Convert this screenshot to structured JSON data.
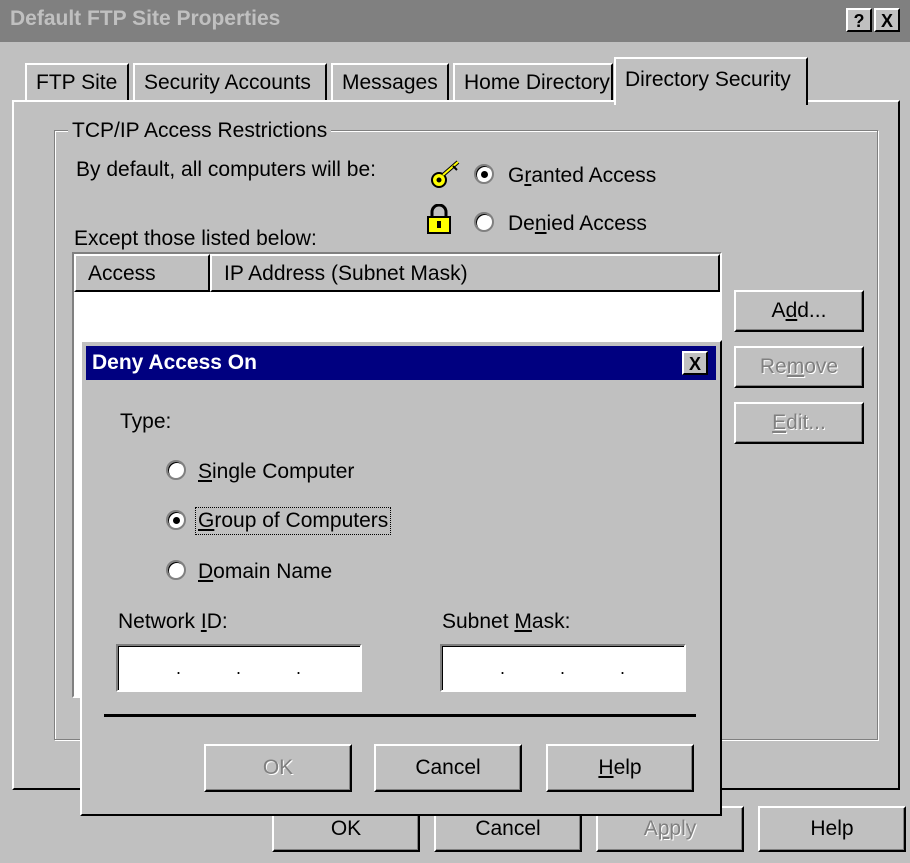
{
  "window": {
    "title": "Default FTP Site Properties",
    "help_btn": "?",
    "close_btn": "X"
  },
  "tabs": [
    {
      "label": "FTP Site"
    },
    {
      "label": "Security Accounts"
    },
    {
      "label": "Messages"
    },
    {
      "label": "Home Directory"
    },
    {
      "label": "Directory Security",
      "active": true
    }
  ],
  "restrictions": {
    "group_label": "TCP/IP Access Restrictions",
    "default_label": "By default, all computers will be:",
    "granted_pre": "G",
    "granted_u": "r",
    "granted_post": "anted Access",
    "denied_pre": "De",
    "denied_u": "n",
    "denied_post": "ied Access",
    "selected": "Granted Access",
    "except_label": "Except those listed below:",
    "columns": [
      "Access",
      "IP Address (Subnet Mask)"
    ],
    "add_pre": "A",
    "add_u": "d",
    "add_post": "d...",
    "remove_pre": "Re",
    "remove_u": "m",
    "remove_post": "ove",
    "edit_u": "E",
    "edit_post": "dit..."
  },
  "deny_dialog": {
    "title": "Deny Access On",
    "close_btn": "X",
    "type_label": "Type:",
    "single_u": "S",
    "single_post": "ingle Computer",
    "group_u": "G",
    "group_post": "roup of Computers",
    "domain_u": "D",
    "domain_post": "omain Name",
    "selected_type": "Group of Computers",
    "network_id_pre": "Network ",
    "network_id_u": "I",
    "network_id_post": "D:",
    "subnet_pre": "Subnet ",
    "subnet_u": "M",
    "subnet_post": "ask:",
    "ip_dots": ".",
    "ok": "OK",
    "cancel": "Cancel",
    "help_u": "H",
    "help_post": "elp"
  },
  "footer": {
    "ok": "OK",
    "cancel": "Cancel",
    "apply_pre": "A",
    "apply_u": "p",
    "apply_post": "ply",
    "help": "Help"
  }
}
